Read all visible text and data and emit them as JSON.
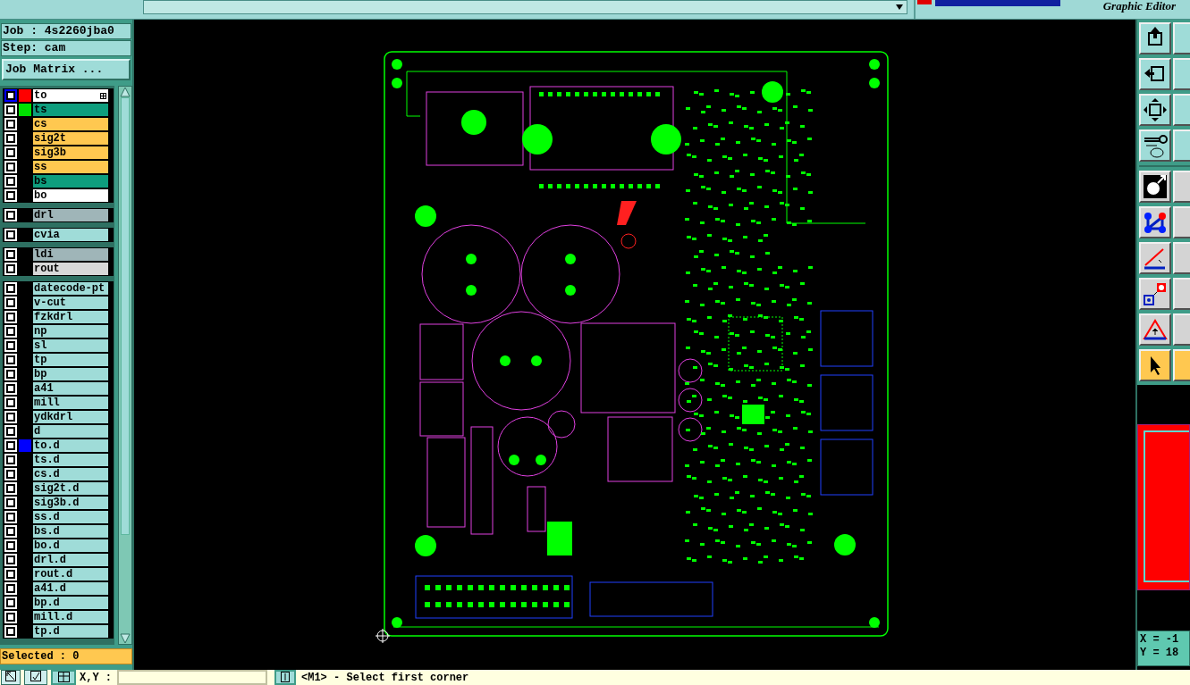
{
  "top_bar": {
    "product": "Graphic Editor"
  },
  "job": {
    "job_label": "Job : 4s2260jba0",
    "step_label": "Step: cam",
    "matrix_button": "Job Matrix ..."
  },
  "layer_groups": [
    {
      "layers": [
        {
          "name": "to",
          "kind": "silk",
          "checked": false,
          "selected": true,
          "color": "#ff0000"
        },
        {
          "name": "ts",
          "kind": "mask",
          "checked": false,
          "selected": false,
          "color": "#00e000"
        },
        {
          "name": "cs",
          "kind": "signal",
          "checked": false,
          "selected": false
        },
        {
          "name": "sig2t",
          "kind": "signal",
          "checked": false,
          "selected": false
        },
        {
          "name": "sig3b",
          "kind": "signal",
          "checked": false,
          "selected": false
        },
        {
          "name": "ss",
          "kind": "signal",
          "checked": false,
          "selected": false
        },
        {
          "name": "bs",
          "kind": "mask",
          "checked": false,
          "selected": false
        },
        {
          "name": "bo",
          "kind": "silk",
          "checked": false,
          "selected": false
        }
      ]
    },
    {
      "layers": [
        {
          "name": "drl",
          "kind": "drill",
          "checked": false,
          "selected": false
        }
      ]
    },
    {
      "layers": [
        {
          "name": "cvia",
          "kind": "misc",
          "checked": false,
          "selected": false
        }
      ]
    },
    {
      "layers": [
        {
          "name": "ldi",
          "kind": "drill",
          "checked": false,
          "selected": false
        },
        {
          "name": "rout",
          "kind": "rout",
          "checked": false,
          "selected": false
        }
      ]
    },
    {
      "layers": [
        {
          "name": "datecode-pt",
          "kind": "misc",
          "checked": false,
          "selected": false
        },
        {
          "name": "v-cut",
          "kind": "misc",
          "checked": false,
          "selected": false
        },
        {
          "name": "fzkdrl",
          "kind": "misc",
          "checked": false,
          "selected": false
        },
        {
          "name": "np",
          "kind": "misc",
          "checked": false,
          "selected": false
        },
        {
          "name": "sl",
          "kind": "misc",
          "checked": false,
          "selected": false
        },
        {
          "name": "tp",
          "kind": "misc",
          "checked": false,
          "selected": false
        },
        {
          "name": "bp",
          "kind": "misc",
          "checked": false,
          "selected": false
        },
        {
          "name": "a41",
          "kind": "misc",
          "checked": false,
          "selected": false
        },
        {
          "name": "mill",
          "kind": "misc",
          "checked": false,
          "selected": false
        },
        {
          "name": "ydkdrl",
          "kind": "misc",
          "checked": false,
          "selected": false
        },
        {
          "name": "d",
          "kind": "misc",
          "checked": false,
          "selected": false
        },
        {
          "name": "to.d",
          "kind": "misc",
          "checked": false,
          "selected": false,
          "color": "#0000ff"
        },
        {
          "name": "ts.d",
          "kind": "misc",
          "checked": false,
          "selected": false
        },
        {
          "name": "cs.d",
          "kind": "misc",
          "checked": false,
          "selected": false
        },
        {
          "name": "sig2t.d",
          "kind": "misc",
          "checked": false,
          "selected": false
        },
        {
          "name": "sig3b.d",
          "kind": "misc",
          "checked": false,
          "selected": false
        },
        {
          "name": "ss.d",
          "kind": "misc",
          "checked": false,
          "selected": false
        },
        {
          "name": "bs.d",
          "kind": "misc",
          "checked": false,
          "selected": false
        },
        {
          "name": "bo.d",
          "kind": "misc",
          "checked": false,
          "selected": false
        },
        {
          "name": "drl.d",
          "kind": "misc",
          "checked": false,
          "selected": false
        },
        {
          "name": "rout.d",
          "kind": "misc",
          "checked": false,
          "selected": false
        },
        {
          "name": "a41.d",
          "kind": "misc",
          "checked": false,
          "selected": false
        },
        {
          "name": "bp.d",
          "kind": "misc",
          "checked": false,
          "selected": false
        },
        {
          "name": "mill.d",
          "kind": "misc",
          "checked": false,
          "selected": false
        },
        {
          "name": "tp.d",
          "kind": "misc",
          "checked": false,
          "selected": false
        }
      ]
    }
  ],
  "selected_count": "Selected : 0",
  "tools": [
    {
      "selected": false
    },
    {
      "selected": false
    },
    {
      "selected": false
    },
    {
      "selected": false
    },
    {
      "selected": false
    },
    {
      "selected": false
    },
    {
      "selected": false
    },
    {
      "selected": false
    },
    {
      "selected": false
    },
    {
      "selected": true
    }
  ],
  "readout": {
    "x": "X = -1",
    "y": "Y = 18"
  },
  "status_bar": {
    "coord_label": "X,Y :",
    "message": "<M1> - Select first corner"
  }
}
